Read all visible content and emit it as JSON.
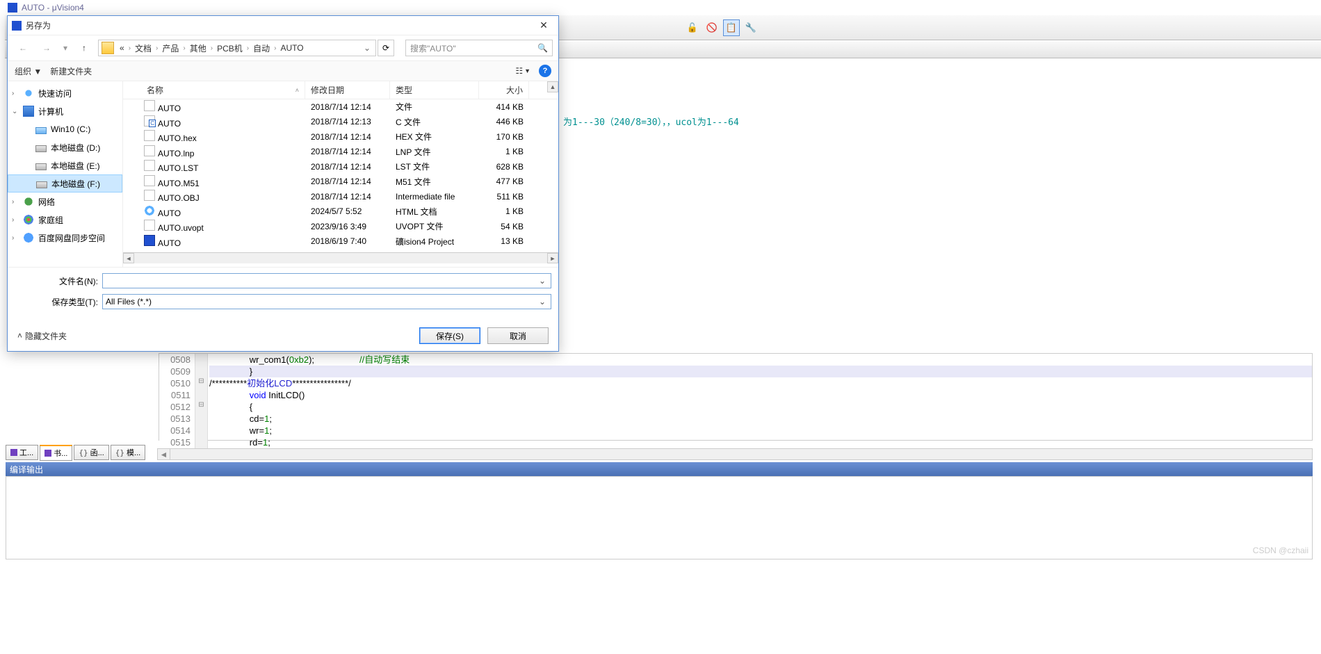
{
  "main_window": {
    "title": "AUTO  - μVision4",
    "output_header": "编译输出",
    "toolbar_icons": [
      "🔴",
      "🟢",
      "🔵",
      "📄",
      "🔧"
    ],
    "bottom_tabs": [
      {
        "label": "工...",
        "icon": "purple"
      },
      {
        "label": "书...",
        "icon": "purple",
        "active": true
      },
      {
        "label": "函...",
        "icon": "brace"
      },
      {
        "label": "模...",
        "icon": "brace"
      }
    ]
  },
  "peek_code": "为1---30（240/8=30），，ucol为1---64",
  "code": {
    "lines": [
      {
        "n": "0508",
        "text": "                wr_com1(0xb2);                  //自动写结束"
      },
      {
        "n": "0509",
        "text": "                }",
        "hl": true
      },
      {
        "n": "0510",
        "text": "/**********初始化LCD****************/",
        "fold": "minus"
      },
      {
        "n": "0511",
        "text": "                void InitLCD()"
      },
      {
        "n": "0512",
        "text": "                {",
        "fold": "minus"
      },
      {
        "n": "0513",
        "text": "                cd=1;"
      },
      {
        "n": "0514",
        "text": "                wr=1;"
      },
      {
        "n": "0515",
        "text": "                rd=1;"
      }
    ]
  },
  "dialog": {
    "title": "另存为",
    "breadcrumb": [
      "«",
      "文档",
      "产品",
      "其他",
      "PCB机",
      "自动",
      "AUTO"
    ],
    "search_placeholder": "搜索\"AUTO\"",
    "toolbar": {
      "organize": "组织 ▼",
      "new_folder": "新建文件夹"
    },
    "sidebar": [
      {
        "label": "快速访问",
        "icon": "star",
        "indent": 0,
        "expand": ">"
      },
      {
        "label": "计算机",
        "icon": "pc",
        "indent": 0,
        "expand": "v"
      },
      {
        "label": "Win10 (C:)",
        "icon": "drive-win",
        "indent": 1
      },
      {
        "label": "本地磁盘 (D:)",
        "icon": "drive",
        "indent": 1
      },
      {
        "label": "本地磁盘 (E:)",
        "icon": "drive",
        "indent": 1
      },
      {
        "label": "本地磁盘 (F:)",
        "icon": "drive",
        "indent": 1,
        "selected": true
      },
      {
        "label": "网络",
        "icon": "net",
        "indent": 0,
        "expand": ">"
      },
      {
        "label": "家庭组",
        "icon": "home",
        "indent": 0,
        "expand": ">"
      },
      {
        "label": "百度网盘同步空间",
        "icon": "cloud",
        "indent": 0,
        "expand": ">"
      }
    ],
    "columns": {
      "name": "名称",
      "date": "修改日期",
      "type": "类型",
      "size": "大小"
    },
    "files": [
      {
        "name": "AUTO",
        "date": "2018/7/14 12:14",
        "type": "文件",
        "size": "414 KB",
        "icon": ""
      },
      {
        "name": "AUTO",
        "date": "2018/7/14 12:13",
        "type": "C 文件",
        "size": "446 KB",
        "icon": "c"
      },
      {
        "name": "AUTO.hex",
        "date": "2018/7/14 12:14",
        "type": "HEX 文件",
        "size": "170 KB",
        "icon": ""
      },
      {
        "name": "AUTO.lnp",
        "date": "2018/7/14 12:14",
        "type": "LNP 文件",
        "size": "1 KB",
        "icon": ""
      },
      {
        "name": "AUTO.LST",
        "date": "2018/7/14 12:14",
        "type": "LST 文件",
        "size": "628 KB",
        "icon": ""
      },
      {
        "name": "AUTO.M51",
        "date": "2018/7/14 12:14",
        "type": "M51 文件",
        "size": "477 KB",
        "icon": ""
      },
      {
        "name": "AUTO.OBJ",
        "date": "2018/7/14 12:14",
        "type": "Intermediate file",
        "size": "511 KB",
        "icon": ""
      },
      {
        "name": "AUTO",
        "date": "2024/5/7 5:52",
        "type": "HTML 文档",
        "size": "1 KB",
        "icon": "html"
      },
      {
        "name": "AUTO.uvopt",
        "date": "2023/9/16 3:49",
        "type": "UVOPT 文件",
        "size": "54 KB",
        "icon": ""
      },
      {
        "name": "AUTO",
        "date": "2018/6/19 7:40",
        "type": "礦ision4 Project",
        "size": "13 KB",
        "icon": "mv"
      }
    ],
    "fields": {
      "filename_label": "文件名(N):",
      "filename_value": "",
      "filetype_label": "保存类型(T):",
      "filetype_value": "All Files (*.*)"
    },
    "footer": {
      "hide_folders": "隐藏文件夹",
      "save": "保存(S)",
      "cancel": "取消"
    }
  },
  "watermark": "CSDN @czhaii"
}
